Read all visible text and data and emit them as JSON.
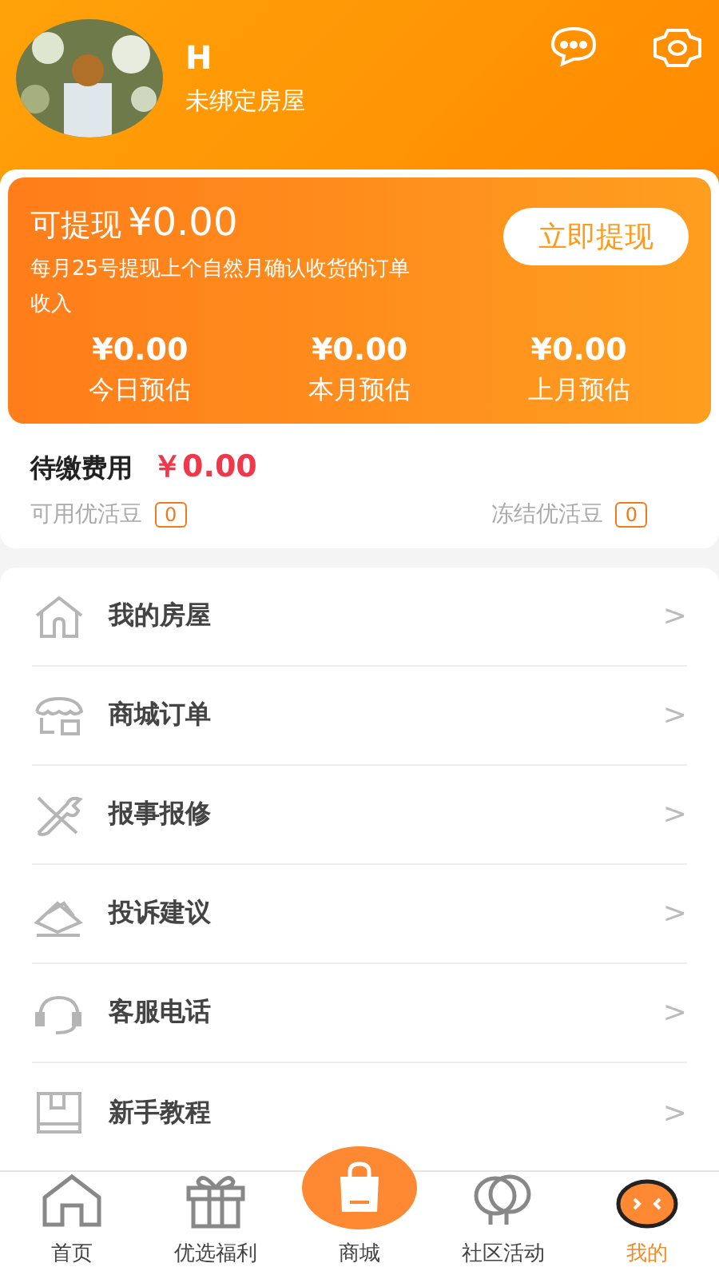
{
  "profile": {
    "name": "H",
    "subtitle": "未绑定房屋"
  },
  "earnings": {
    "withdrawable_label": "可提现",
    "withdrawable_amount": "¥0.00",
    "withdraw_button": "立即提现",
    "note": "每月25号提现上个自然月确认收货的订单收入",
    "stats": [
      {
        "value": "¥0.00",
        "label": "今日预估"
      },
      {
        "value": "¥0.00",
        "label": "本月预估"
      },
      {
        "value": "¥0.00",
        "label": "上月预估"
      }
    ]
  },
  "fees": {
    "label": "待缴费用",
    "amount": "￥0.00"
  },
  "beans": [
    {
      "label": "可用优活豆",
      "count": "0"
    },
    {
      "label": "冻结优活豆",
      "count": "0"
    }
  ],
  "menu": [
    {
      "label": "我的房屋",
      "chevron": ">"
    },
    {
      "label": "商城订单",
      "chevron": ">"
    },
    {
      "label": "报事报修",
      "chevron": ">"
    },
    {
      "label": "投诉建议",
      "chevron": ">"
    },
    {
      "label": "客服电话",
      "chevron": ">"
    },
    {
      "label": "新手教程",
      "chevron": ">"
    }
  ],
  "tabs": [
    {
      "label": "首页",
      "selected": false
    },
    {
      "label": "优选福利",
      "selected": false
    },
    {
      "label": "商城",
      "selected": false
    },
    {
      "label": "社区活动",
      "selected": false
    },
    {
      "label": "我的",
      "selected": true
    }
  ]
}
